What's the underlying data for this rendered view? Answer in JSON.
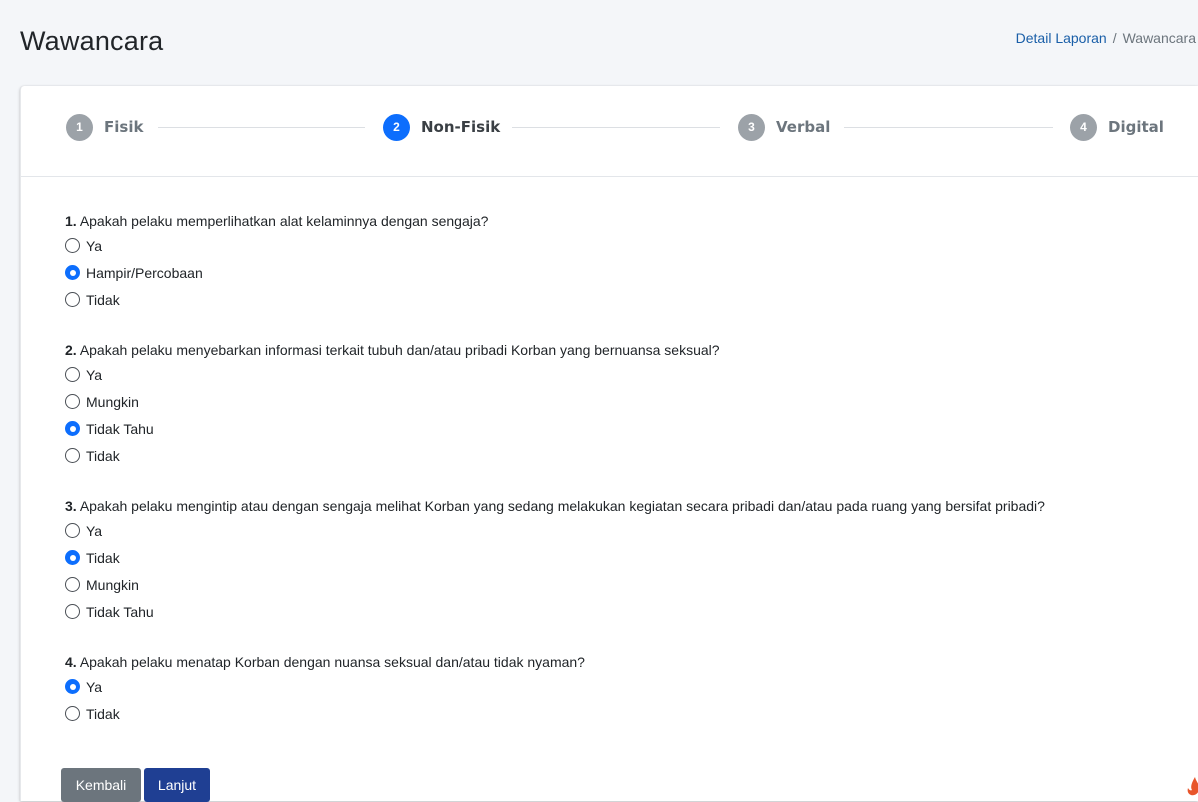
{
  "page": {
    "title": "Wawancara",
    "breadcrumb": [
      {
        "label": "Detail Laporan",
        "link": true
      },
      {
        "label": "Wawancara",
        "link": false
      }
    ],
    "breadcrumb_separator": "/"
  },
  "stepper": [
    {
      "number": "1",
      "label": "Fisik",
      "active": false
    },
    {
      "number": "2",
      "label": "Non-Fisik",
      "active": true
    },
    {
      "number": "3",
      "label": "Verbal",
      "active": false
    },
    {
      "number": "4",
      "label": "Digital",
      "active": false
    }
  ],
  "questions": [
    {
      "number": "1.",
      "text": "Apakah pelaku memperlihatkan alat kelaminnya dengan sengaja?",
      "options": [
        "Ya",
        "Hampir/Percobaan",
        "Tidak"
      ],
      "selected": "Hampir/Percobaan"
    },
    {
      "number": "2.",
      "text": "Apakah pelaku menyebarkan informasi terkait tubuh dan/atau pribadi Korban yang bernuansa seksual?",
      "options": [
        "Ya",
        "Mungkin",
        "Tidak Tahu",
        "Tidak"
      ],
      "selected": "Tidak Tahu"
    },
    {
      "number": "3.",
      "text": "Apakah pelaku mengintip atau dengan sengaja melihat Korban yang sedang melakukan kegiatan secara pribadi dan/atau pada ruang yang bersifat pribadi?",
      "options": [
        "Ya",
        "Tidak",
        "Mungkin",
        "Tidak Tahu"
      ],
      "selected": "Tidak"
    },
    {
      "number": "4.",
      "text": "Apakah pelaku menatap Korban dengan nuansa seksual dan/atau tidak nyaman?",
      "options": [
        "Ya",
        "Tidak"
      ],
      "selected": "Ya"
    }
  ],
  "buttons": {
    "back_label": "Kembali",
    "next_label": "Lanjut"
  },
  "colors": {
    "primary": "#0d6efd",
    "step_inactive": "#9ca2a8",
    "back_button": "#6c757d",
    "next_button": "#1f3f93",
    "link": "#1a5fa8"
  }
}
